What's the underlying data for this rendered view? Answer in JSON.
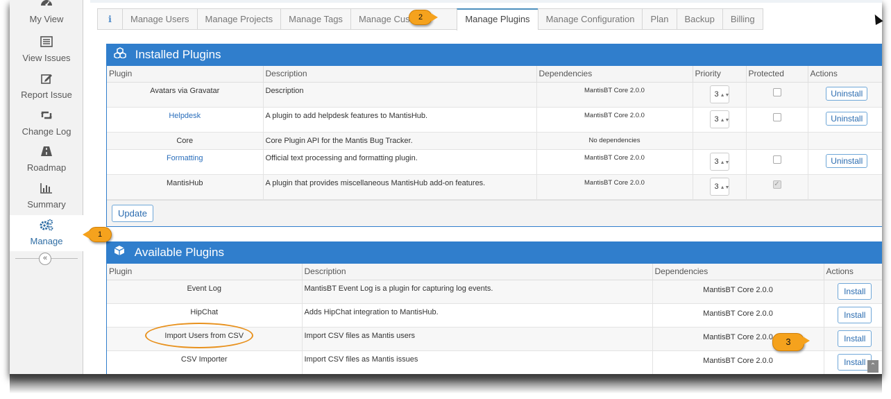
{
  "sidebar": {
    "items": [
      {
        "label": "My View",
        "icon": "dashboard-icon"
      },
      {
        "label": "View Issues",
        "icon": "list-icon"
      },
      {
        "label": "Report Issue",
        "icon": "edit-icon"
      },
      {
        "label": "Change Log",
        "icon": "retweet-icon"
      },
      {
        "label": "Roadmap",
        "icon": "road-icon"
      },
      {
        "label": "Summary",
        "icon": "bar-chart-icon"
      },
      {
        "label": "Manage",
        "icon": "gears-icon"
      }
    ],
    "collapse_glyph": "«"
  },
  "tabs": [
    {
      "label": "ℹ"
    },
    {
      "label": "Manage Users"
    },
    {
      "label": "Manage Projects"
    },
    {
      "label": "Manage Tags"
    },
    {
      "label": "Manage Custom"
    },
    {
      "label": "Manage Plugins"
    },
    {
      "label": "Manage Configuration"
    },
    {
      "label": "Plan"
    },
    {
      "label": "Backup"
    },
    {
      "label": "Billing"
    }
  ],
  "installed": {
    "title": "Installed Plugins",
    "columns": [
      "Plugin",
      "Description",
      "Dependencies",
      "Priority",
      "Protected",
      "Actions"
    ],
    "rows": [
      {
        "name": "Avatars via Gravatar",
        "desc": "Description",
        "deps": "MantisBT Core 2.0.0",
        "priority": "3",
        "action": "Uninstall"
      },
      {
        "name": "Helpdesk",
        "desc": "A plugin to add helpdesk features to MantisHub.",
        "deps": "MantisBT Core 2.0.0",
        "priority": "3",
        "action": "Uninstall"
      },
      {
        "name": "Core",
        "desc": "Core Plugin API for the Mantis Bug Tracker.",
        "deps": "No dependencies"
      },
      {
        "name": "Formatting",
        "desc": "Official text processing and formatting plugin.",
        "deps": "MantisBT Core 2.0.0",
        "priority": "3",
        "action": "Uninstall"
      },
      {
        "name": "MantisHub",
        "desc": "A plugin that provides miscellaneous MantisHub add-on features.",
        "deps": "MantisBT Core 2.0.0",
        "priority": "3"
      }
    ],
    "update_label": "Update"
  },
  "available": {
    "title": "Available Plugins",
    "columns": [
      "Plugin",
      "Description",
      "Dependencies",
      "Actions"
    ],
    "rows": [
      {
        "name": "Event Log",
        "desc": "MantisBT Event Log is a plugin for capturing log events.",
        "deps": "MantisBT Core 2.0.0",
        "action": "Install"
      },
      {
        "name": "HipChat",
        "desc": "Adds HipChat integration to MantisHub.",
        "deps": "MantisBT Core 2.0.0",
        "action": "Install"
      },
      {
        "name": "Import Users from CSV",
        "desc": "Import CSV files as Mantis users",
        "deps": "MantisBT Core 2.0.0",
        "action": "Install"
      },
      {
        "name": "CSV Importer",
        "desc": "Import CSV files as Mantis issues",
        "deps": "MantisBT Core 2.0.0",
        "action": "Install"
      }
    ]
  },
  "callouts": {
    "one": "1",
    "two": "2",
    "three": "3"
  },
  "colors": {
    "accent": "#307ecc",
    "callout": "#f5a21d"
  }
}
